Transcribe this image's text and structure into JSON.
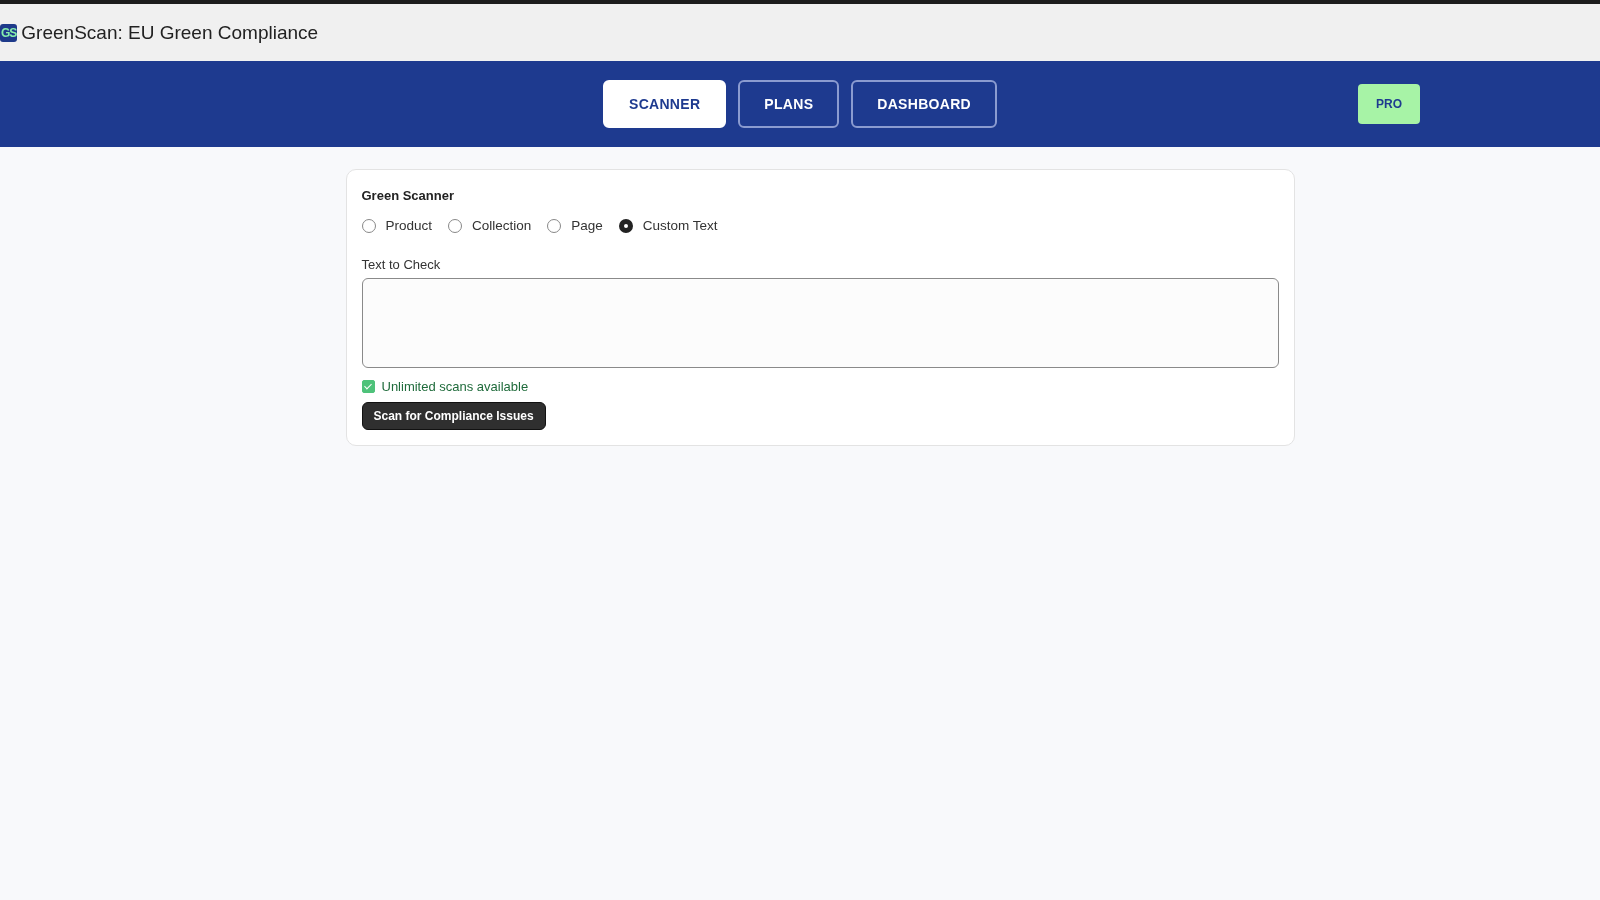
{
  "window": {
    "logo": "GS",
    "title": "GreenScan: EU Green Compliance"
  },
  "nav": {
    "tabs": [
      {
        "label": "SCANNER",
        "selected": true
      },
      {
        "label": "PLANS",
        "selected": false
      },
      {
        "label": "DASHBOARD",
        "selected": false
      }
    ],
    "badge": "PRO"
  },
  "scanner": {
    "title": "Green Scanner",
    "options": [
      {
        "label": "Product",
        "selected": false
      },
      {
        "label": "Collection",
        "selected": false
      },
      {
        "label": "Page",
        "selected": false
      },
      {
        "label": "Custom Text",
        "selected": true
      }
    ],
    "field_label": "Text to Check",
    "status": {
      "label": "Unlimited scans available",
      "checked": true
    },
    "button": "Scan for Compliance Issues"
  }
}
